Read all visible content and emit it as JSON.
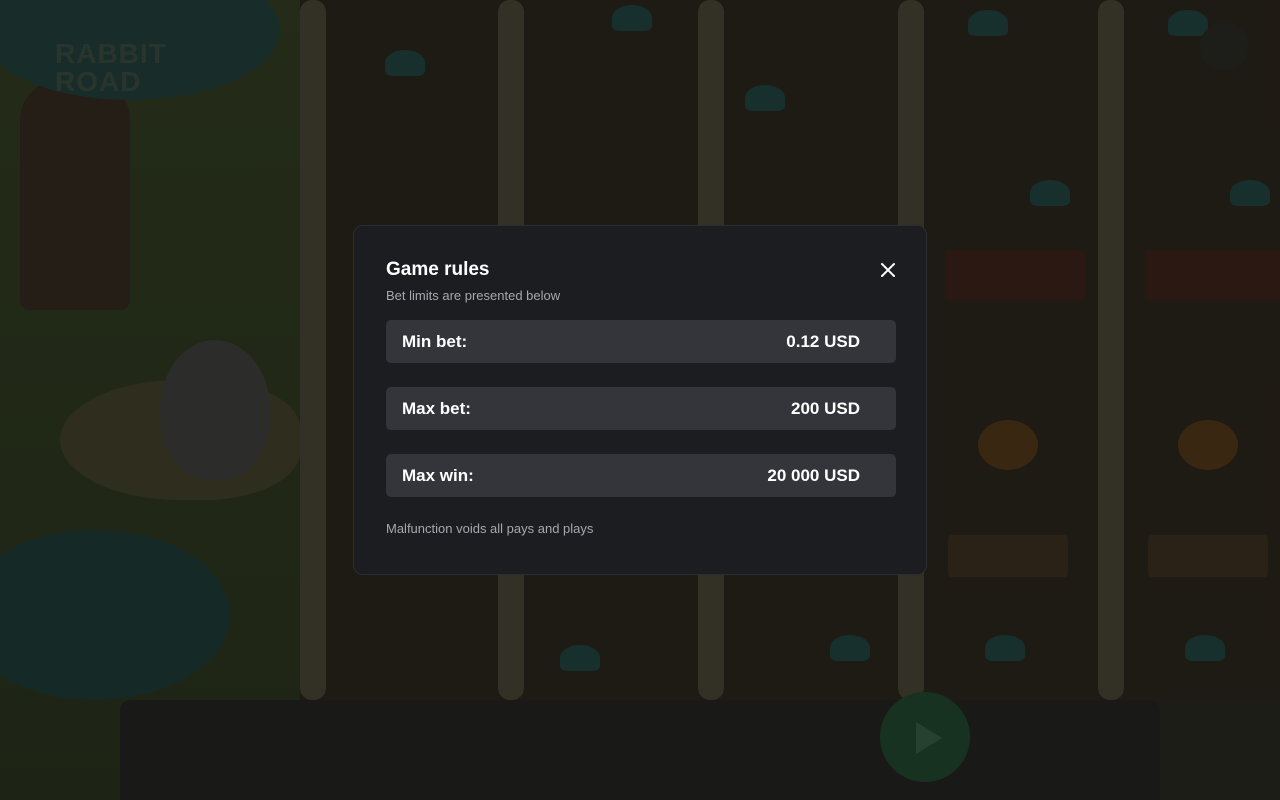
{
  "modal": {
    "title": "Game rules",
    "subtitle": "Bet limits are presented below",
    "close_icon": "close-icon",
    "rows": [
      {
        "label": "Min bet:",
        "value": "0.12 USD"
      },
      {
        "label": "Max bet:",
        "value": "200 USD"
      },
      {
        "label": "Max win:",
        "value": "20 000 USD"
      }
    ],
    "footnote": "Malfunction voids all pays and plays"
  },
  "colors": {
    "modal_background": "#1c1d21",
    "row_background": "#34353b",
    "title_text": "#ffffff",
    "muted_text": "#a7a8ad",
    "play_button": "#1e5a34"
  }
}
